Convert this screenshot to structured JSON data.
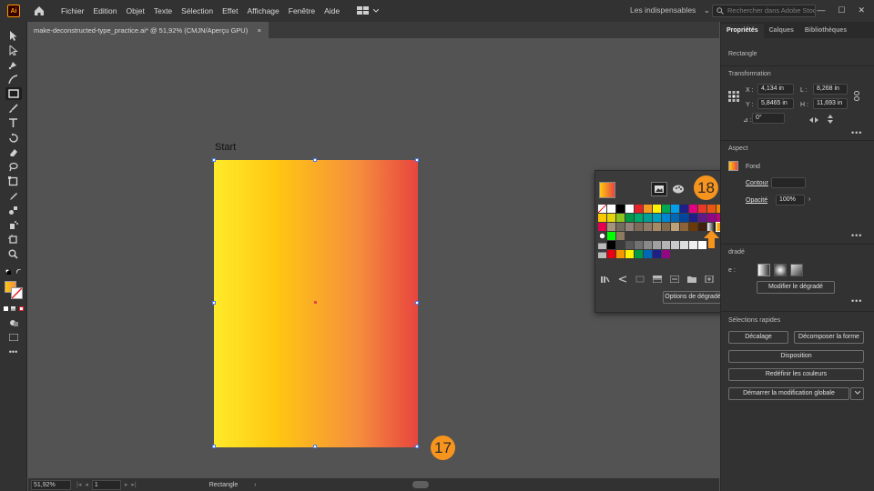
{
  "app": {
    "logo_text": "Ai"
  },
  "menu": [
    "Fichier",
    "Edition",
    "Objet",
    "Texte",
    "Sélection",
    "Effet",
    "Affichage",
    "Fenêtre",
    "Aide"
  ],
  "workspace": {
    "label": "Les indispensables",
    "chevron": "⌄"
  },
  "search": {
    "placeholder": "Rechercher dans Adobe Stock"
  },
  "window_controls": [
    "—",
    "☐",
    "✕"
  ],
  "document": {
    "tab_title": "make-deconstructed-type_practice.ai* @ 51,92% (CMJN/Aperçu GPU)",
    "close": "×"
  },
  "artboard": {
    "label": "Start"
  },
  "badges": {
    "step17": "17",
    "step18": "18"
  },
  "swatches": {
    "options_label": "Options de dégradé",
    "rows": [
      [
        "none",
        "#ffffff",
        "#000000",
        "#ffffff",
        "#e62129",
        "#f39820",
        "#fff100",
        "#00a650",
        "#00a0e9",
        "#1d2088",
        "#e4007f",
        "#e83828",
        "#e95513",
        "#f08300",
        "#f6ab00"
      ],
      [
        "#fcc800",
        "#e4d709",
        "#8fc31f",
        "#009944",
        "#00a96b",
        "#009e96",
        "#00a0c1",
        "#0086d1",
        "#0068b7",
        "#00479d",
        "#1d2088",
        "#601986",
        "#920783",
        "#be0081",
        "#e5006a"
      ],
      [
        "#e5004f",
        "#a6937c",
        "#726c5e",
        "#928178",
        "#7d6b58",
        "#8f7a66",
        "#a68a64",
        "#7e6b4d",
        "#bda279",
        "#8c6239",
        "#6a3906",
        "#40220f",
        "grad-a",
        "grad-b",
        "grad-c"
      ],
      [
        "circle",
        "#00ff00",
        "#8c7b61"
      ],
      [
        "folder",
        "#000000",
        "#3c3c3c",
        "#595757",
        "#727171",
        "#898989",
        "#9fa0a0",
        "#b5b5b6",
        "#c9caca",
        "#dcdddd",
        "#efefef",
        "#ffffff"
      ],
      [
        "folder",
        "#e60012",
        "#f39800",
        "#fff100",
        "#009944",
        "#0068b7",
        "#1d2088",
        "#920783"
      ]
    ]
  },
  "properties": {
    "tabs": [
      "Propriétés",
      "Calques",
      "Bibliothèques"
    ],
    "object_type": "Rectangle",
    "transform_title": "Transformation",
    "x_label": "X :",
    "x_value": "4,134 in",
    "y_label": "Y :",
    "y_value": "5,8465 in",
    "w_label": "L :",
    "w_value": "8,268 in",
    "h_label": "H :",
    "h_value": "11,693 in",
    "angle_label": "⊿ :",
    "angle_value": "0°",
    "aspect_title": "Aspect",
    "fill_label": "Fond",
    "stroke_label": "Contour",
    "opacity_label": "Opacité",
    "opacity_value": "100%",
    "gradient_title": "dradé",
    "type_label": "e :",
    "edit_gradient": "Modifier le dégradé",
    "quick_title": "Sélections rapides",
    "btn_offset": "Décalage",
    "btn_expand": "Décomposer la forme",
    "btn_arrange": "Disposition",
    "btn_recolor": "Redéfinir les couleurs",
    "btn_global": "Démarrer la modification globale",
    "more": "•••"
  },
  "status": {
    "zoom": "51,92%",
    "page": "1",
    "tool_text": "Rectangle"
  },
  "colors": {
    "accent": "#f7941d",
    "gradient_start": "#ffea2a",
    "gradient_end": "#e8453f"
  }
}
